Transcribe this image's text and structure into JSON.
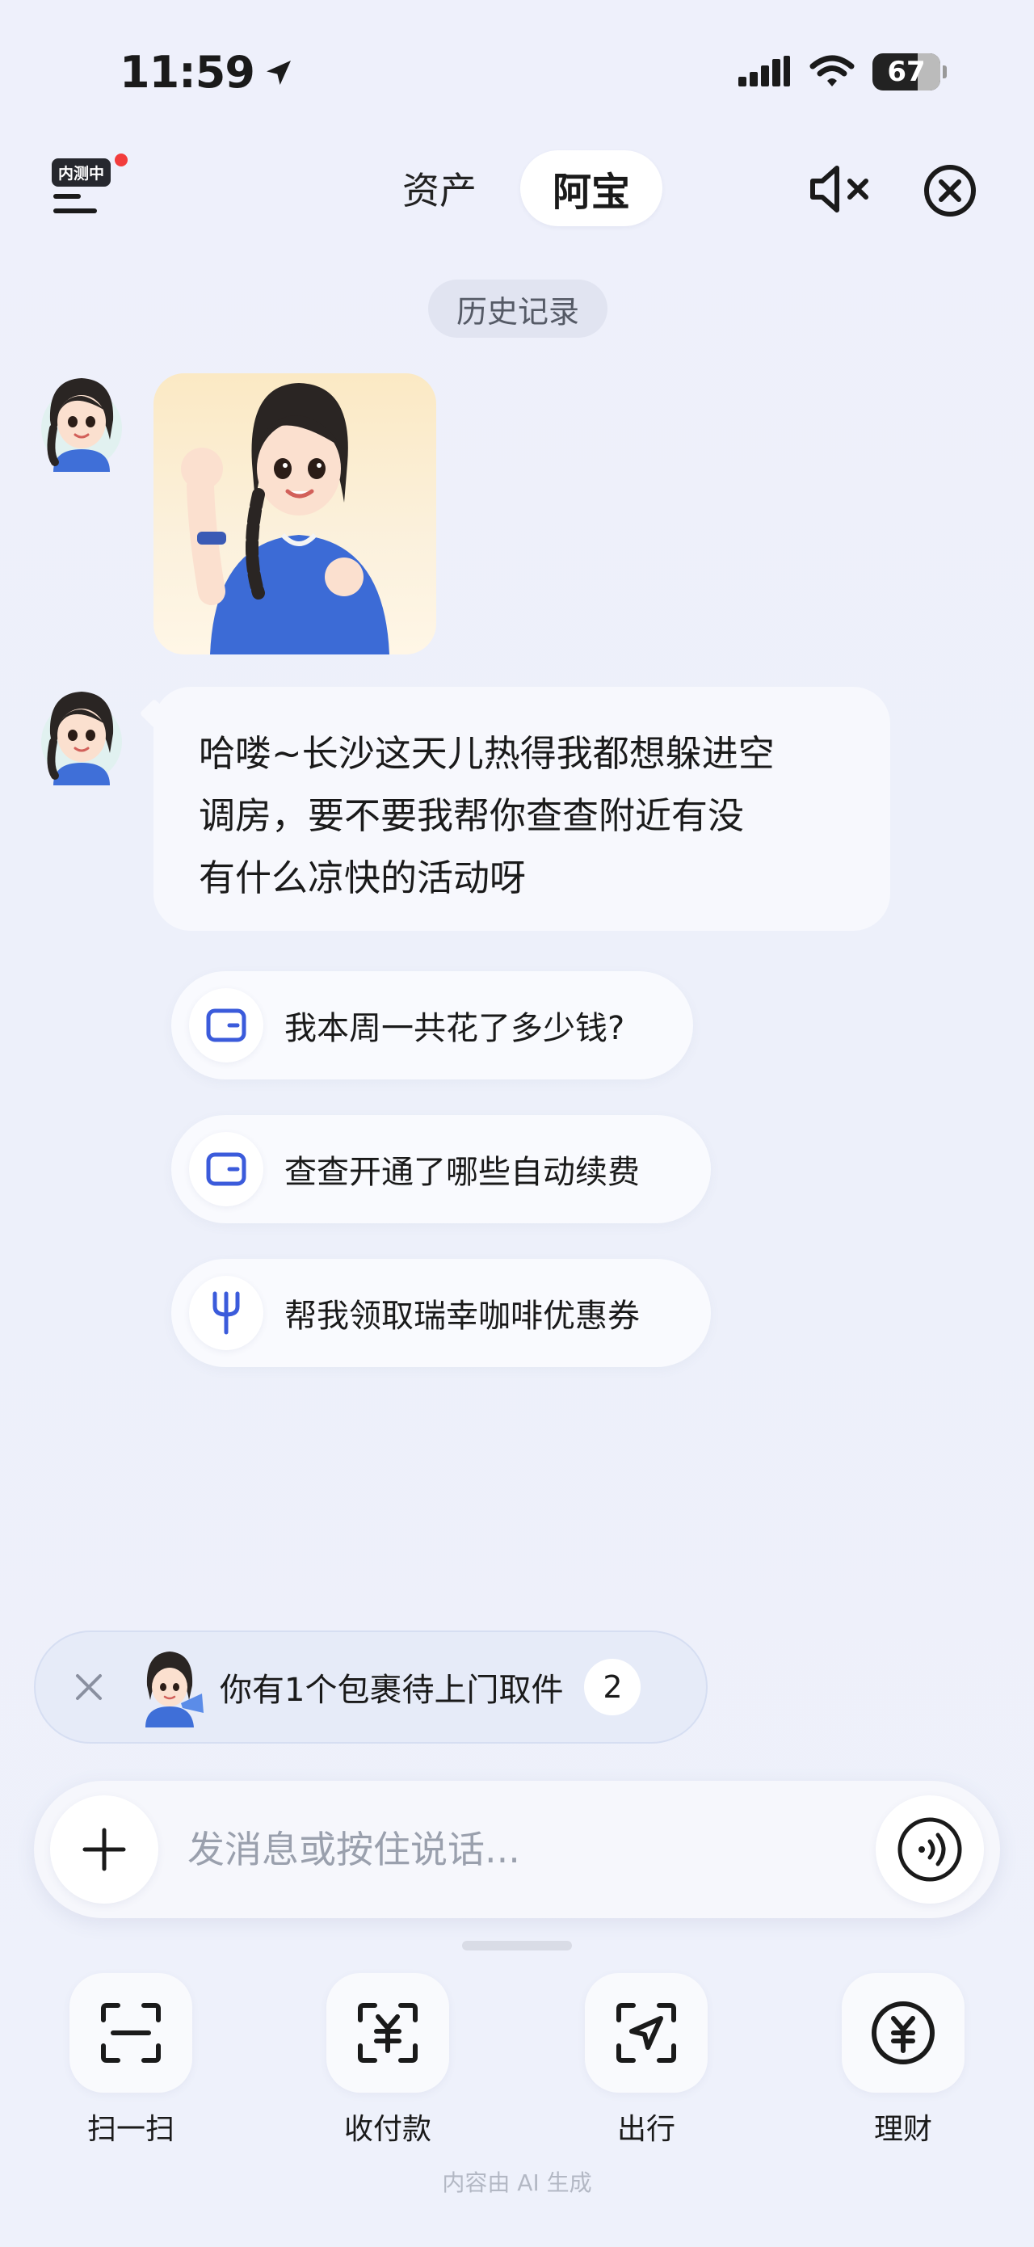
{
  "status_bar": {
    "time": "11:59",
    "battery": "67"
  },
  "header": {
    "beta_badge": "内测中",
    "tab_assets": "资产",
    "tab_abao": "阿宝"
  },
  "history_button": "历史记录",
  "message": {
    "text_line1": "哈喽~长沙这天儿热得我都想躲进空",
    "text_line2": "调房，要不要我帮你查查附近有没",
    "text_line3": "有什么凉快的活动呀"
  },
  "suggestions": [
    {
      "icon": "wallet-icon",
      "label": "我本周一共花了多少钱?"
    },
    {
      "icon": "wallet-icon",
      "label": "查查开通了哪些自动续费"
    },
    {
      "icon": "fork-icon",
      "label": "帮我领取瑞幸咖啡优惠券"
    }
  ],
  "notification": {
    "text": "你有1个包裹待上门取件",
    "count": "2"
  },
  "input": {
    "placeholder": "发消息或按住说话..."
  },
  "quick_actions": [
    {
      "icon": "scan-icon",
      "label": "扫一扫"
    },
    {
      "icon": "yuan-receipt-icon",
      "label": "收付款"
    },
    {
      "icon": "navigation-icon",
      "label": "出行"
    },
    {
      "icon": "yuan-circle-icon",
      "label": "理财"
    }
  ],
  "footer_note": "内容由 AI 生成",
  "colors": {
    "accent_blue": "#3b5bdb",
    "background": "#eef0fb",
    "red_dot": "#f23c3c"
  }
}
